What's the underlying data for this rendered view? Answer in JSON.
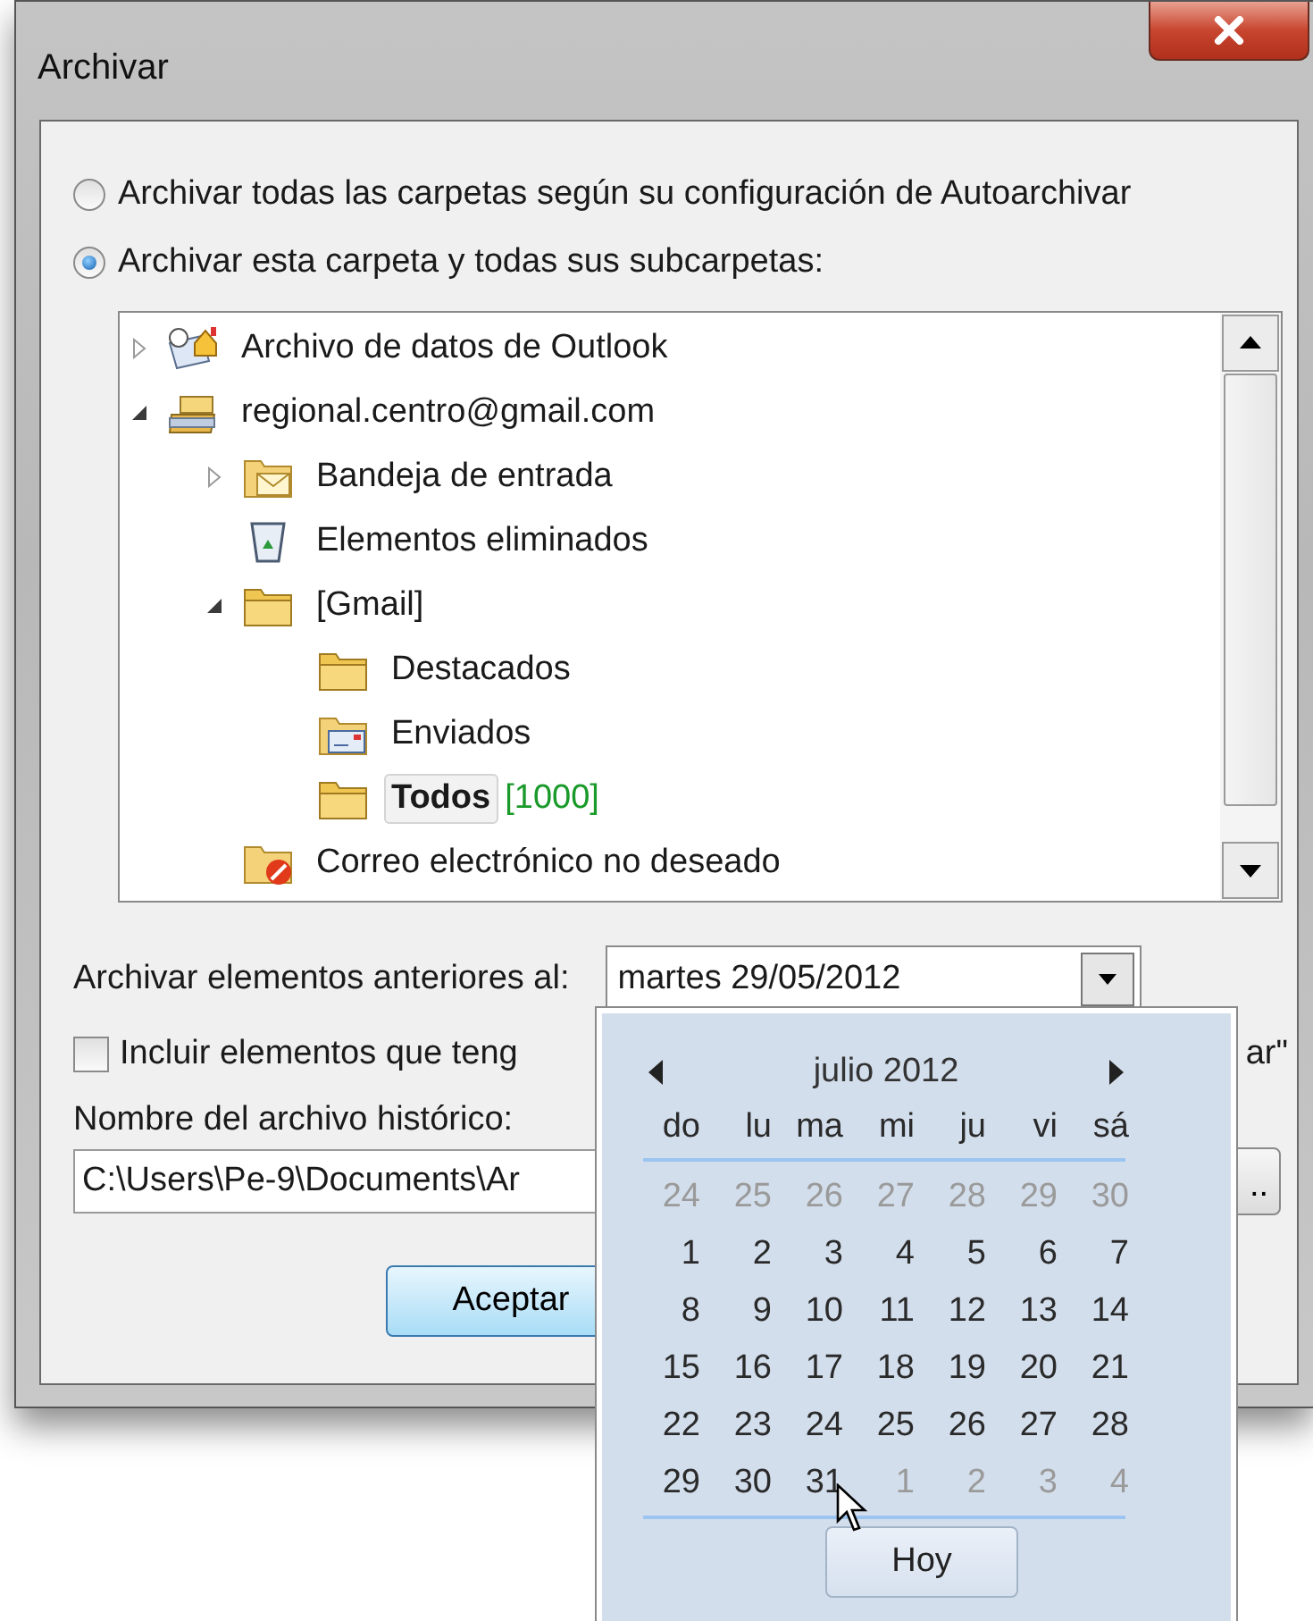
{
  "window": {
    "title": "Archivar"
  },
  "scope_options": [
    {
      "label": "Archivar todas las carpetas según su configuración de Autoarchivar",
      "selected": false
    },
    {
      "label": "Archivar esta carpeta y todas sus subcarpetas:",
      "selected": true
    }
  ],
  "tree": {
    "items": [
      {
        "label": "Archivo de datos de Outlook",
        "kind": "data-file",
        "expanded": false,
        "selected": false
      },
      {
        "label": "regional.centro@gmail.com",
        "kind": "account",
        "expanded": true,
        "selected": false,
        "children": [
          {
            "label": "Bandeja de entrada",
            "kind": "inbox",
            "expanded": false,
            "selected": false
          },
          {
            "label": "Elementos eliminados",
            "kind": "trash",
            "selected": false
          },
          {
            "label": "[Gmail]",
            "kind": "folder",
            "expanded": true,
            "selected": false,
            "children": [
              {
                "label": "Destacados",
                "kind": "folder",
                "selected": false
              },
              {
                "label": "Enviados",
                "kind": "sent",
                "selected": false
              },
              {
                "label": "Todos",
                "kind": "folder",
                "selected": true,
                "count": "[1000]"
              }
            ]
          },
          {
            "label": "Correo electrónico no deseado",
            "kind": "junk",
            "selected": false
          }
        ]
      }
    ]
  },
  "date_label": "Archivar elementos anteriores al:",
  "date_value": "martes 29/05/2012",
  "include_option": {
    "label": "Incluir elementos que teng",
    "checked": false
  },
  "include_option_tail": "ar\"",
  "file_label": "Nombre del archivo histórico:",
  "file_path": "C:\\Users\\Pe-9\\Documents\\Ar",
  "browse_button": "..",
  "ok_button": "Aceptar",
  "calendar": {
    "month": "julio 2012",
    "weekdays": [
      "do",
      "lu",
      "ma",
      "mi",
      "ju",
      "vi",
      "sá"
    ],
    "weeks": [
      [
        {
          "day": "24",
          "in_month": false
        },
        {
          "day": "25",
          "in_month": false
        },
        {
          "day": "26",
          "in_month": false
        },
        {
          "day": "27",
          "in_month": false
        },
        {
          "day": "28",
          "in_month": false
        },
        {
          "day": "29",
          "in_month": false
        },
        {
          "day": "30",
          "in_month": false
        }
      ],
      [
        {
          "day": "1",
          "in_month": true
        },
        {
          "day": "2",
          "in_month": true
        },
        {
          "day": "3",
          "in_month": true
        },
        {
          "day": "4",
          "in_month": true
        },
        {
          "day": "5",
          "in_month": true
        },
        {
          "day": "6",
          "in_month": true
        },
        {
          "day": "7",
          "in_month": true
        }
      ],
      [
        {
          "day": "8",
          "in_month": true
        },
        {
          "day": "9",
          "in_month": true
        },
        {
          "day": "10",
          "in_month": true
        },
        {
          "day": "11",
          "in_month": true
        },
        {
          "day": "12",
          "in_month": true
        },
        {
          "day": "13",
          "in_month": true
        },
        {
          "day": "14",
          "in_month": true
        }
      ],
      [
        {
          "day": "15",
          "in_month": true
        },
        {
          "day": "16",
          "in_month": true
        },
        {
          "day": "17",
          "in_month": true
        },
        {
          "day": "18",
          "in_month": true
        },
        {
          "day": "19",
          "in_month": true
        },
        {
          "day": "20",
          "in_month": true
        },
        {
          "day": "21",
          "in_month": true
        }
      ],
      [
        {
          "day": "22",
          "in_month": true
        },
        {
          "day": "23",
          "in_month": true
        },
        {
          "day": "24",
          "in_month": true
        },
        {
          "day": "25",
          "in_month": true
        },
        {
          "day": "26",
          "in_month": true
        },
        {
          "day": "27",
          "in_month": true
        },
        {
          "day": "28",
          "in_month": true
        }
      ],
      [
        {
          "day": "29",
          "in_month": true
        },
        {
          "day": "30",
          "in_month": true
        },
        {
          "day": "31",
          "in_month": true
        },
        {
          "day": "1",
          "in_month": false
        },
        {
          "day": "2",
          "in_month": false
        },
        {
          "day": "3",
          "in_month": false
        },
        {
          "day": "4",
          "in_month": false
        }
      ]
    ],
    "today_button": "Hoy"
  }
}
